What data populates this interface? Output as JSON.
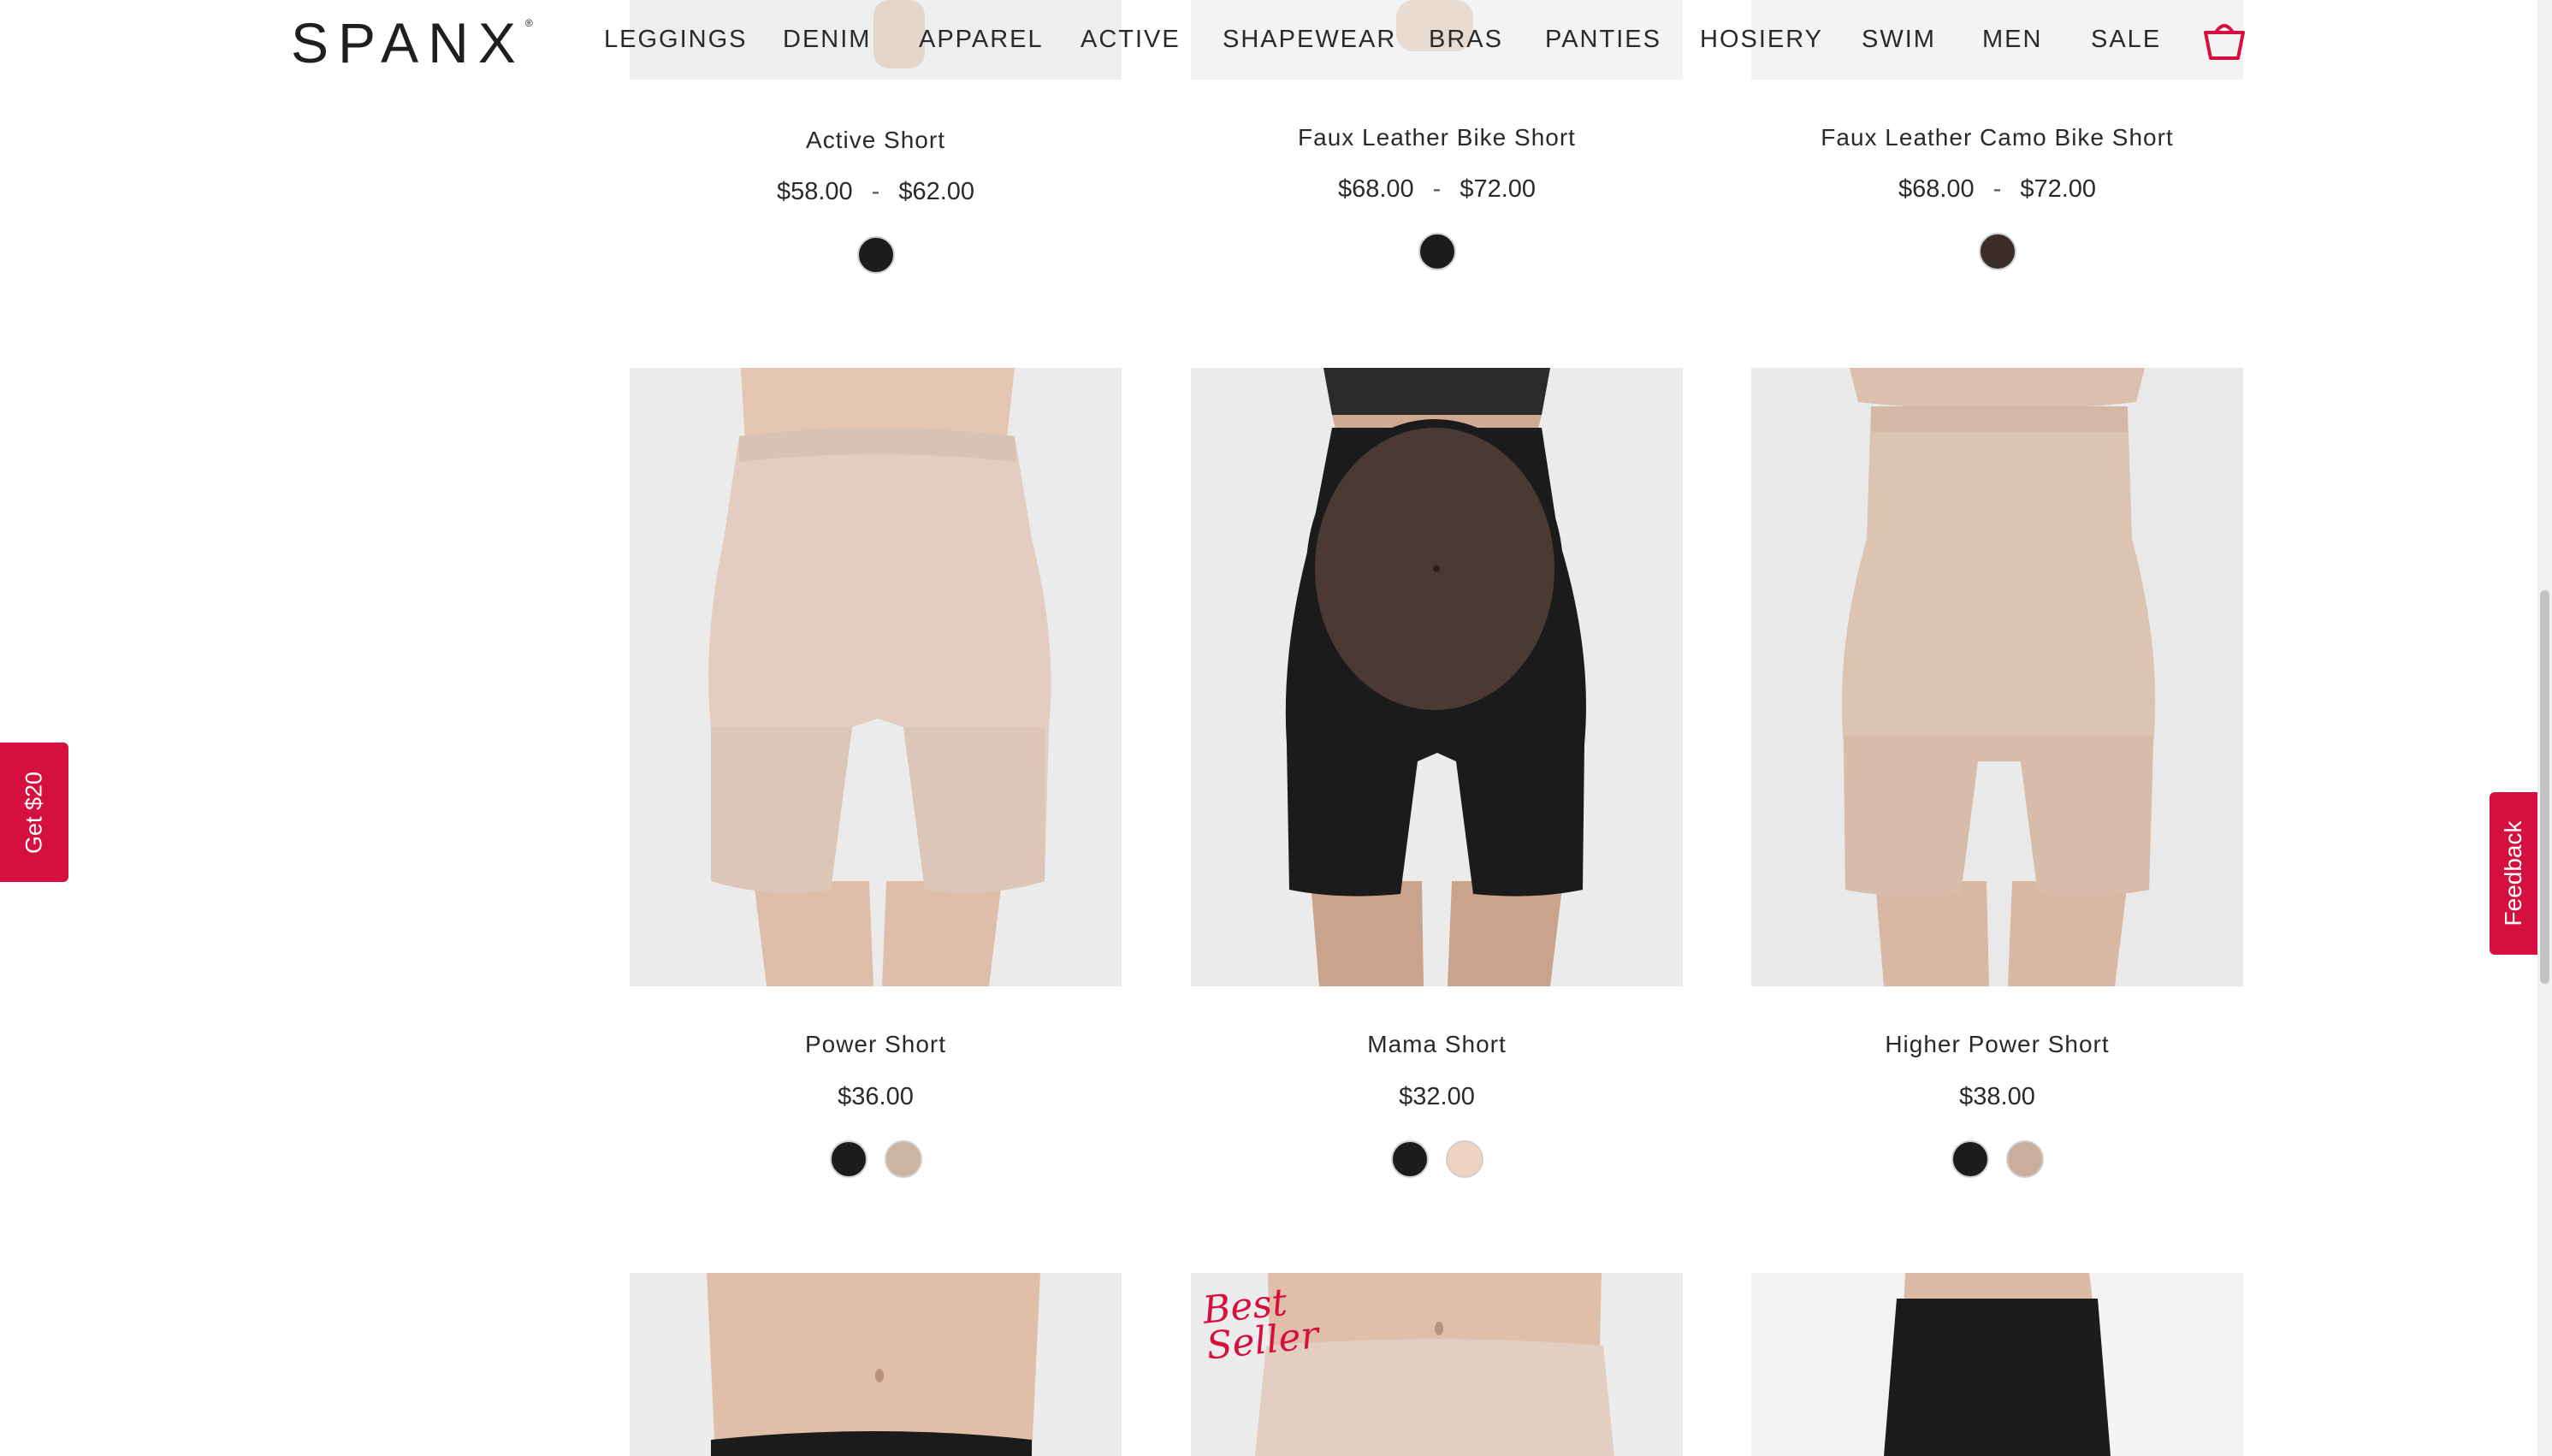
{
  "brand": {
    "logo_text": "SPANX",
    "logo_mark": "®"
  },
  "nav": {
    "items": [
      "LEGGINGS",
      "DENIM",
      "APPAREL",
      "ACTIVE",
      "SHAPEWEAR",
      "BRAS",
      "PANTIES",
      "HOSIERY",
      "SWIM",
      "MEN",
      "SALE"
    ],
    "cart_icon": "shopping-bag-icon"
  },
  "products_top": [
    {
      "name": "Active Short",
      "price_low": "$58.00",
      "price_sep": "-",
      "price_high": "$62.00",
      "swatches": [
        "#1c1c1c"
      ]
    },
    {
      "name": "Faux Leather Bike Short",
      "price_low": "$68.00",
      "price_sep": "-",
      "price_high": "$72.00",
      "swatches": [
        "#1c1c1c"
      ]
    },
    {
      "name": "Faux Leather Camo Bike Short",
      "price_low": "$68.00",
      "price_sep": "-",
      "price_high": "$72.00",
      "swatches": [
        "#3a2e26"
      ]
    }
  ],
  "products_middle": [
    {
      "name": "Power Short",
      "price": "$36.00",
      "swatches": [
        "#1c1c1c",
        "#cdb3a2"
      ]
    },
    {
      "name": "Mama Short",
      "price": "$32.00",
      "swatches": [
        "#1c1c1c",
        "#efd4c3"
      ]
    },
    {
      "name": "Higher Power Short",
      "price": "$38.00",
      "swatches": [
        "#1c1c1c",
        "#c9ae9c"
      ]
    }
  ],
  "badge": {
    "line1": "Best",
    "line2": "Seller"
  },
  "side_tabs": {
    "left_label": "Get $20",
    "right_label": "Feedback"
  },
  "colors": {
    "accent": "#d6103e",
    "image_bg": "#eeeeee"
  }
}
